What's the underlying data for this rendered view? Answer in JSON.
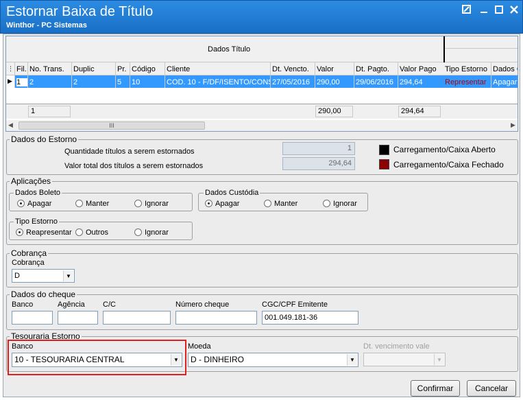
{
  "window": {
    "title": "Estornar Baixa de Título",
    "subtitle": "Winthor - PC Sistemas"
  },
  "grid": {
    "group_header": "Dados Título",
    "columns": [
      "Fil.",
      "No. Trans.",
      "Duplic",
      "Pr.",
      "Código",
      "Cliente",
      "Dt. Vencto.",
      "Valor",
      "Dt. Pagto.",
      "Valor Pago",
      "Tipo Estorno",
      "Dados C"
    ],
    "row": [
      "1",
      "2",
      "2",
      "5",
      "10",
      "COD. 10 - F/DF/ISENTO/CONS.",
      "27/05/2016",
      "290,00",
      "29/06/2016",
      "294,64",
      "Representar",
      "Apagar"
    ],
    "footer_count": "1",
    "footer_valor": "290,00",
    "footer_valor_pago": "294,64",
    "scroll_grip": "III"
  },
  "dados_estorno": {
    "title": "Dados do Estorno",
    "qtd_label": "Quantidade títulos a serem estornados",
    "qtd_value": "1",
    "total_label": "Valor total dos títulos a serem estornados",
    "total_value": "294,64",
    "legend_open": "Carregamento/Caixa Aberto",
    "legend_closed": "Carregamento/Caixa Fechado",
    "color_open": "#000000",
    "color_closed": "#8b0000"
  },
  "aplicacoes": {
    "title": "Aplicações",
    "boleto_title": "Dados Boleto",
    "boleto_options": [
      "Apagar",
      "Manter",
      "Ignorar"
    ],
    "custodia_title": "Dados Custódia",
    "custodia_options": [
      "Apagar",
      "Manter",
      "Ignorar"
    ],
    "tipo_title": "Tipo Estorno",
    "tipo_options": [
      "Reapresentar",
      "Outros",
      "Ignorar"
    ]
  },
  "cobranca": {
    "title": "Cobrança",
    "label": "Cobrança",
    "value": "D"
  },
  "cheque": {
    "title": "Dados do cheque",
    "banco_label": "Banco",
    "agencia_label": "Agência",
    "cc_label": "C/C",
    "numero_label": "Número cheque",
    "cgc_label": "CGC/CPF Emitente",
    "cgc_value": "001.049.181-36"
  },
  "tesouraria": {
    "title": "Tesouraria Estorno",
    "banco_label": "Banco",
    "banco_value": "10 - TESOURARIA CENTRAL",
    "moeda_label": "Moeda",
    "moeda_value": "D - DINHEIRO",
    "vencimento_label": "Dt. vencimento vale",
    "highlight_color": "#e02020"
  },
  "buttons": {
    "confirm": "Confirmar",
    "cancel": "Cancelar"
  }
}
